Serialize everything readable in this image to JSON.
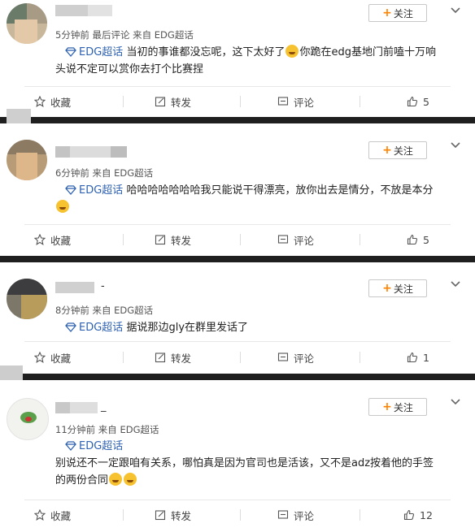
{
  "colors": {
    "topic": "#2f62b0",
    "accent": "#ff8200",
    "separator": "#1f1f1f"
  },
  "comments": [
    {
      "meta": "5分钟前 最后评论 来自 EDG超话",
      "follow_label": "关注",
      "topic": "EDG超话",
      "text_before_emoji": "当初的事谁都没忘呢，这下太好了",
      "emoji": "grinning-sweat-emoji",
      "text_line1_tail": "你跪在edg基地门前嗑十万响",
      "text_line2": "头说不定可以赏你去打个比赛捏",
      "actions": {
        "favorite": "收藏",
        "repost": "转发",
        "comment": "评论",
        "likes": "5"
      }
    },
    {
      "meta": "6分钟前 来自 EDG超话",
      "follow_label": "关注",
      "topic": "EDG超话",
      "text_line1": "哈哈哈哈哈哈哈我只能说干得漂亮，放你出去是情分，不放是本分",
      "emoji": "rofl-emoji",
      "actions": {
        "favorite": "收藏",
        "repost": "转发",
        "comment": "评论",
        "likes": "5"
      }
    },
    {
      "name_fragment": "-",
      "meta": "8分钟前 来自 EDG超话",
      "follow_label": "关注",
      "topic": "EDG超话",
      "text_line1": "据说那边gly在群里发话了",
      "actions": {
        "favorite": "收藏",
        "repost": "转发",
        "comment": "评论",
        "likes": "1"
      }
    },
    {
      "name_fragment": "_",
      "meta": "11分钟前 来自 EDG超话",
      "follow_label": "关注",
      "topic": "EDG超话",
      "text_line1": "别说还不一定跟咱有关系，哪怕真是因为官司也是活该，又不是adz按着他的手签",
      "text_line2": "的两份合同",
      "emoji": "peeking-emoji",
      "actions": {
        "favorite": "收藏",
        "repost": "转发",
        "comment": "评论",
        "likes": "12"
      }
    }
  ]
}
